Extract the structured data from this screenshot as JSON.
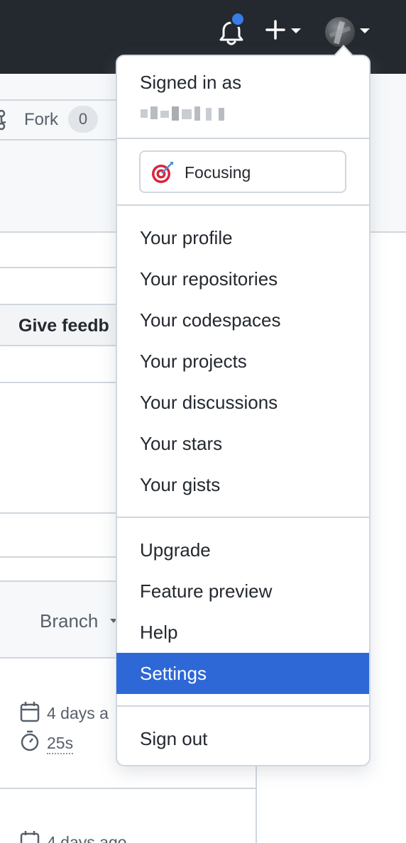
{
  "header": {
    "notifications_icon": "bell-icon",
    "create_icon": "plus-icon",
    "avatar_icon": "avatar"
  },
  "repo": {
    "fork_label": "Fork",
    "fork_count": "0",
    "feedback_button": "Give feedb",
    "branch_label": "Branch",
    "run_date": "4 days a",
    "run_duration": "25s",
    "run_date_2": "4 days ago"
  },
  "menu": {
    "signed_in_label": "Signed in as",
    "status_label": "Focusing",
    "status_emoji": "dart-icon",
    "items_group1": [
      "Your profile",
      "Your repositories",
      "Your codespaces",
      "Your projects",
      "Your discussions",
      "Your stars",
      "Your gists"
    ],
    "items_group2": [
      "Upgrade",
      "Feature preview",
      "Help",
      "Settings"
    ],
    "sign_out": "Sign out",
    "highlighted": "Settings"
  },
  "colors": {
    "header_bg": "#24292f",
    "highlight": "#2d68d6",
    "notification_dot": "#3a7bea"
  }
}
